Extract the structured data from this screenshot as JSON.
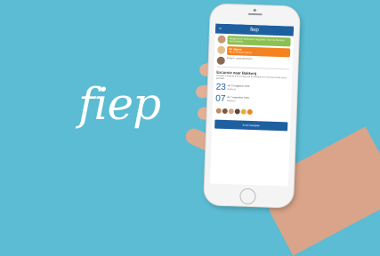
{
  "brand": {
    "logo_text": "fiep"
  },
  "app": {
    "header_title": "fiep",
    "feed": [
      {
        "type": "message",
        "text": "Morgen even 'Schoenen' wegzetten. Voor de Excursie naar Bakkerij.",
        "color": "#8cc152"
      },
      {
        "type": "announcement",
        "title": "De Jaguar",
        "subtitle": "Nieuw bericht in groep",
        "color": "#f58220"
      }
    ],
    "group_label": "Groep 6 - groepsleerkracht",
    "event": {
      "title": "Excursie naar Bakkerij",
      "description": "We gaan met groep 6 op 23 aug naar de bakkerij om te zien hoe brood wordt gemaakt.",
      "dates": [
        {
          "day": "23",
          "line1": "wo 23 augustus 2016",
          "line2": "Bakkerij"
        },
        {
          "day": "07",
          "line1": "do 7 september 2016",
          "line2": "Bakkerij"
        }
      ],
      "cta_label": "Ik wil meerijden"
    }
  }
}
